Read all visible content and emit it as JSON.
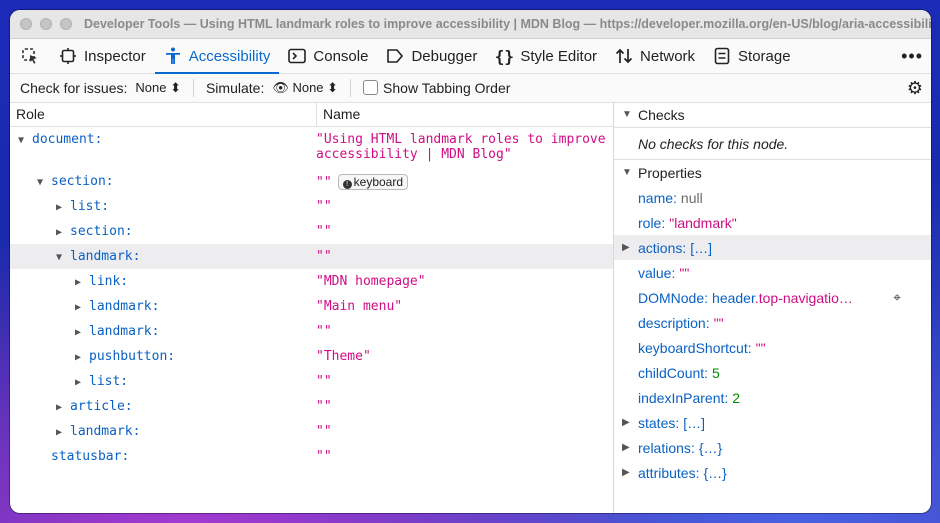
{
  "window": {
    "title": "Developer Tools — Using HTML landmark roles to improve accessibility | MDN Blog — https://developer.mozilla.org/en-US/blog/aria-accessibility-..."
  },
  "toolbar": {
    "tabs": [
      {
        "label": "Inspector",
        "icon": "inspector-icon"
      },
      {
        "label": "Accessibility",
        "icon": "accessibility-icon",
        "active": true
      },
      {
        "label": "Console",
        "icon": "console-icon"
      },
      {
        "label": "Debugger",
        "icon": "debugger-icon"
      },
      {
        "label": "Style Editor",
        "icon": "style-editor-icon"
      },
      {
        "label": "Network",
        "icon": "network-icon"
      },
      {
        "label": "Storage",
        "icon": "storage-icon"
      }
    ],
    "more": "•••"
  },
  "filters": {
    "check_label": "Check for issues:",
    "check_value": "None ⬍",
    "simulate_label": "Simulate:",
    "simulate_value": "None ⬍",
    "tabbing_label": "Show Tabbing Order"
  },
  "tree": {
    "headers": {
      "role": "Role",
      "name": "Name"
    },
    "rows": [
      {
        "role": "document:",
        "name": "\"Using HTML landmark roles to improve\naccessibility | MDN Blog\"",
        "toggle": "open"
      },
      {
        "role": "section:",
        "name": "\"\"",
        "toggle": "open",
        "badge": "keyboard"
      },
      {
        "role": "list:",
        "name": "\"\"",
        "toggle": "closed"
      },
      {
        "role": "section:",
        "name": "\"\"",
        "toggle": "closed"
      },
      {
        "role": "landmark:",
        "name": "\"\"",
        "toggle": "open",
        "selected": true
      },
      {
        "role": "link:",
        "name": "\"MDN homepage\"",
        "toggle": "closed"
      },
      {
        "role": "landmark:",
        "name": "\"Main menu\"",
        "toggle": "closed"
      },
      {
        "role": "landmark:",
        "name": "\"\"",
        "toggle": "closed"
      },
      {
        "role": "pushbutton:",
        "name": "\"Theme\"",
        "toggle": "closed"
      },
      {
        "role": "list:",
        "name": "\"\"",
        "toggle": "closed"
      },
      {
        "role": "article:",
        "name": "\"\"",
        "toggle": "closed"
      },
      {
        "role": "landmark:",
        "name": "\"\"",
        "toggle": "closed"
      },
      {
        "role": "statusbar:",
        "name": "\"\"",
        "toggle": "none"
      }
    ]
  },
  "checks": {
    "header": "Checks",
    "message": "No checks for this node."
  },
  "properties": {
    "header": "Properties",
    "items": [
      {
        "key": "name:",
        "value": "null",
        "kind": "null"
      },
      {
        "key": "role:",
        "value": "\"landmark\"",
        "kind": "str"
      },
      {
        "key": "actions:",
        "value": "[…]",
        "kind": "obj",
        "toggle": true,
        "selected": true
      },
      {
        "key": "value:",
        "value": "\"\"",
        "kind": "str"
      },
      {
        "key": "DOMNode:",
        "value": "header",
        "value_class": ".top-navigatio…",
        "kind": "dom"
      },
      {
        "key": "description:",
        "value": "\"\"",
        "kind": "str"
      },
      {
        "key": "keyboardShortcut:",
        "value": "\"\"",
        "kind": "str"
      },
      {
        "key": "childCount:",
        "value": "5",
        "kind": "num"
      },
      {
        "key": "indexInParent:",
        "value": "2",
        "kind": "num"
      },
      {
        "key": "states:",
        "value": "[…]",
        "kind": "obj",
        "toggle": true
      },
      {
        "key": "relations:",
        "value": "{…}",
        "kind": "obj",
        "toggle": true
      },
      {
        "key": "attributes:",
        "value": "{…}",
        "kind": "obj",
        "toggle": true
      }
    ]
  }
}
